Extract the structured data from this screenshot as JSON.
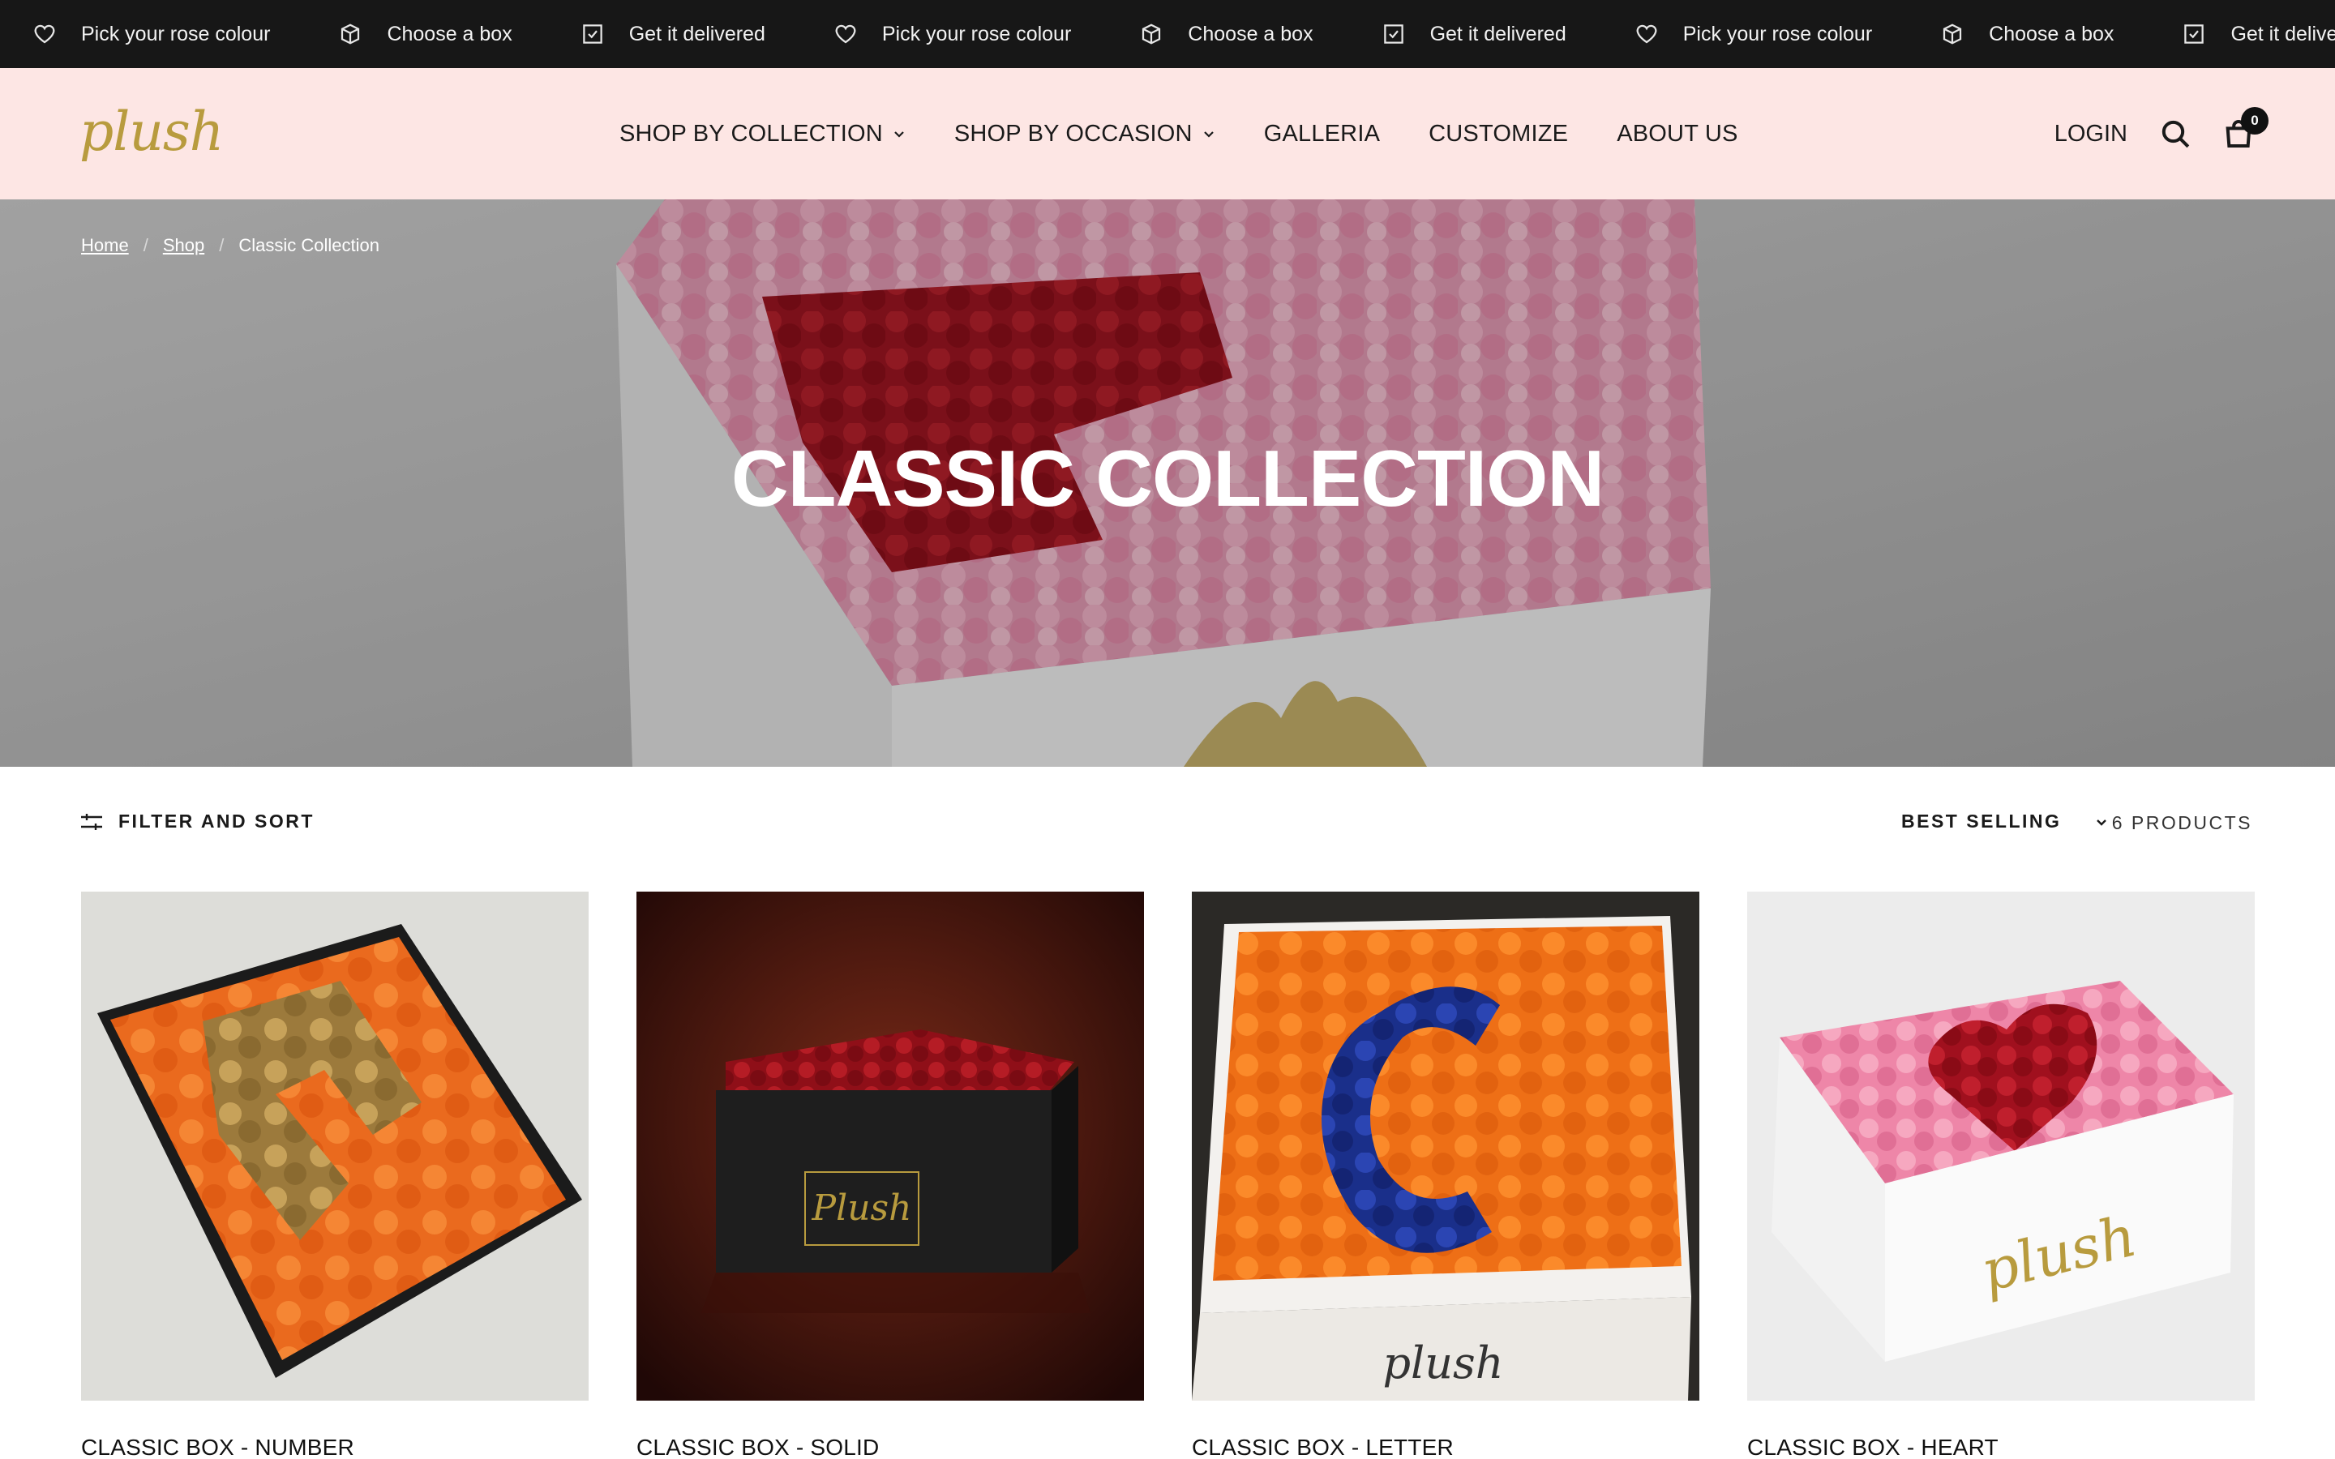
{
  "announcement": {
    "items": [
      {
        "icon": "heart-icon",
        "label": "Pick your rose colour"
      },
      {
        "icon": "box-icon",
        "label": "Choose a box"
      },
      {
        "icon": "checkbox-icon",
        "label": "Get it delivered"
      },
      {
        "icon": "heart-icon",
        "label": "Pick your rose colour"
      },
      {
        "icon": "box-icon",
        "label": "Choose a box"
      },
      {
        "icon": "checkbox-icon",
        "label": "Get it delivered"
      },
      {
        "icon": "heart-icon",
        "label": "Pick your rose colour"
      },
      {
        "icon": "box-icon",
        "label": "Choose a box"
      },
      {
        "icon": "checkbox-icon",
        "label": "Get it delivered"
      }
    ]
  },
  "header": {
    "logo": "plush",
    "nav": [
      {
        "label": "SHOP BY COLLECTION",
        "has_dropdown": true
      },
      {
        "label": "SHOP BY OCCASION",
        "has_dropdown": true
      },
      {
        "label": "GALLERIA",
        "has_dropdown": false
      },
      {
        "label": "CUSTOMIZE",
        "has_dropdown": false
      },
      {
        "label": "ABOUT US",
        "has_dropdown": false
      }
    ],
    "login_label": "LOGIN",
    "cart_count": "0"
  },
  "hero": {
    "breadcrumb": [
      "Home",
      "Shop",
      "Classic Collection"
    ],
    "title": "CLASSIC COLLECTION"
  },
  "toolbar": {
    "filter_label": "FILTER AND SORT",
    "sort_value": "BEST SELLING",
    "product_count": "6 PRODUCTS"
  },
  "products": [
    {
      "title": "CLASSIC BOX - NUMBER"
    },
    {
      "title": "CLASSIC BOX - SOLID"
    },
    {
      "title": "CLASSIC BOX - LETTER"
    },
    {
      "title": "CLASSIC BOX - HEART"
    }
  ],
  "colors": {
    "announcement_bg": "#171717",
    "header_bg": "#fde6e4",
    "logo_gold": "#b89b3e",
    "text_dark": "#111111"
  }
}
